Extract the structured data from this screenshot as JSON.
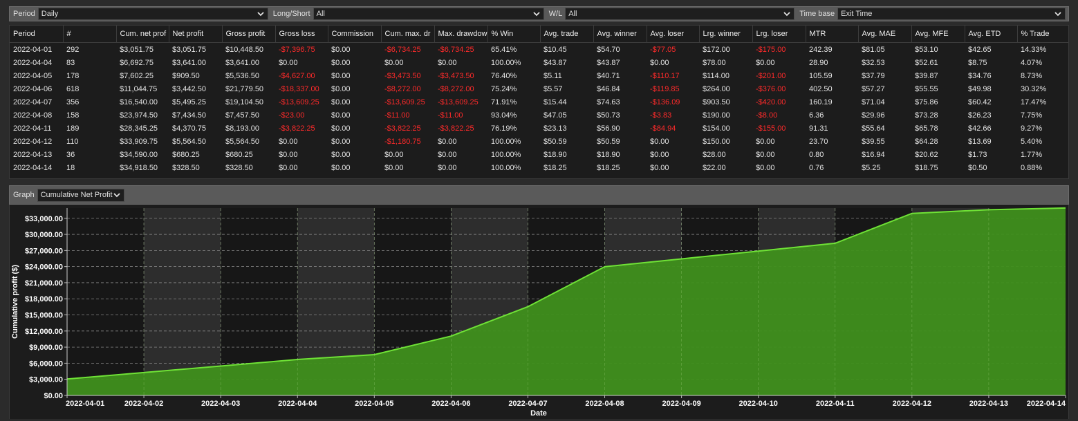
{
  "filters": [
    {
      "label": "Period",
      "value": "Daily"
    },
    {
      "label": "Long/Short",
      "value": "All"
    },
    {
      "label": "W/L",
      "value": "All"
    },
    {
      "label": "Time base",
      "value": "Exit Time"
    }
  ],
  "table": {
    "columns": [
      "Period",
      "#",
      "Cum. net prof",
      "Net profit",
      "Gross profit",
      "Gross loss",
      "Commission",
      "Cum. max. dr",
      "Max. drawdow",
      "% Win",
      "Avg. trade",
      "Avg. winner",
      "Avg. loser",
      "Lrg. winner",
      "Lrg. loser",
      "MTR",
      "Avg. MAE",
      "Avg. MFE",
      "Avg. ETD",
      "% Trade"
    ],
    "rows": [
      [
        "2022-04-01",
        "292",
        "$3,051.75",
        "$3,051.75",
        "$10,448.50",
        "-$7,396.75",
        "$0.00",
        "-$6,734.25",
        "-$6,734.25",
        "65.41%",
        "$10.45",
        "$54.70",
        "-$77.05",
        "$172.00",
        "-$175.00",
        "242.39",
        "$81.05",
        "$53.10",
        "$42.65",
        "14.33%"
      ],
      [
        "2022-04-04",
        "83",
        "$6,692.75",
        "$3,641.00",
        "$3,641.00",
        "$0.00",
        "$0.00",
        "$0.00",
        "$0.00",
        "100.00%",
        "$43.87",
        "$43.87",
        "$0.00",
        "$78.00",
        "$0.00",
        "28.90",
        "$32.53",
        "$52.61",
        "$8.75",
        "4.07%"
      ],
      [
        "2022-04-05",
        "178",
        "$7,602.25",
        "$909.50",
        "$5,536.50",
        "-$4,627.00",
        "$0.00",
        "-$3,473.50",
        "-$3,473.50",
        "76.40%",
        "$5.11",
        "$40.71",
        "-$110.17",
        "$114.00",
        "-$201.00",
        "105.59",
        "$37.79",
        "$39.87",
        "$34.76",
        "8.73%"
      ],
      [
        "2022-04-06",
        "618",
        "$11,044.75",
        "$3,442.50",
        "$21,779.50",
        "-$18,337.00",
        "$0.00",
        "-$8,272.00",
        "-$8,272.00",
        "75.24%",
        "$5.57",
        "$46.84",
        "-$119.85",
        "$264.00",
        "-$376.00",
        "402.50",
        "$57.27",
        "$55.55",
        "$49.98",
        "30.32%"
      ],
      [
        "2022-04-07",
        "356",
        "$16,540.00",
        "$5,495.25",
        "$19,104.50",
        "-$13,609.25",
        "$0.00",
        "-$13,609.25",
        "-$13,609.25",
        "71.91%",
        "$15.44",
        "$74.63",
        "-$136.09",
        "$903.50",
        "-$420.00",
        "160.19",
        "$71.04",
        "$75.86",
        "$60.42",
        "17.47%"
      ],
      [
        "2022-04-08",
        "158",
        "$23,974.50",
        "$7,434.50",
        "$7,457.50",
        "-$23.00",
        "$0.00",
        "-$11.00",
        "-$11.00",
        "93.04%",
        "$47.05",
        "$50.73",
        "-$3.83",
        "$190.00",
        "-$8.00",
        "6.36",
        "$29.96",
        "$73.28",
        "$26.23",
        "7.75%"
      ],
      [
        "2022-04-11",
        "189",
        "$28,345.25",
        "$4,370.75",
        "$8,193.00",
        "-$3,822.25",
        "$0.00",
        "-$3,822.25",
        "-$3,822.25",
        "76.19%",
        "$23.13",
        "$56.90",
        "-$84.94",
        "$154.00",
        "-$155.00",
        "91.31",
        "$55.64",
        "$65.78",
        "$42.66",
        "9.27%"
      ],
      [
        "2022-04-12",
        "110",
        "$33,909.75",
        "$5,564.50",
        "$5,564.50",
        "$0.00",
        "$0.00",
        "-$1,180.75",
        "$0.00",
        "100.00%",
        "$50.59",
        "$50.59",
        "$0.00",
        "$150.00",
        "$0.00",
        "23.70",
        "$39.55",
        "$64.28",
        "$13.69",
        "5.40%"
      ],
      [
        "2022-04-13",
        "36",
        "$34,590.00",
        "$680.25",
        "$680.25",
        "$0.00",
        "$0.00",
        "$0.00",
        "$0.00",
        "100.00%",
        "$18.90",
        "$18.90",
        "$0.00",
        "$28.00",
        "$0.00",
        "0.80",
        "$16.94",
        "$20.62",
        "$1.73",
        "1.77%"
      ],
      [
        "2022-04-14",
        "18",
        "$34,918.50",
        "$328.50",
        "$328.50",
        "$0.00",
        "$0.00",
        "$0.00",
        "$0.00",
        "100.00%",
        "$18.25",
        "$18.25",
        "$0.00",
        "$22.00",
        "$0.00",
        "0.76",
        "$5.25",
        "$18.75",
        "$0.50",
        "0.88%"
      ]
    ]
  },
  "graph": {
    "label": "Graph",
    "selected": "Cumulative Net Profit"
  },
  "colors": {
    "negative": "#ff2a2a",
    "area_fill": "#3f8f1c",
    "line": "#6fe236",
    "plot_bg_dark": "#171717",
    "plot_bg_band": "#2d2d2d"
  },
  "chart_data": {
    "type": "area",
    "xlabel": "Date",
    "ylabel": "Cumulative profit ($)",
    "x": [
      "2022-04-01",
      "2022-04-02",
      "2022-04-03",
      "2022-04-04",
      "2022-04-05",
      "2022-04-06",
      "2022-04-07",
      "2022-04-08",
      "2022-04-09",
      "2022-04-10",
      "2022-04-11",
      "2022-04-12",
      "2022-04-13",
      "2022-04-14"
    ],
    "series": [
      {
        "values": [
          3051.75,
          4265,
          5479,
          6692.75,
          7602.25,
          11044.75,
          16540.0,
          23974.5,
          25431,
          26888,
          28345.25,
          33909.75,
          34590.0,
          34918.5
        ]
      }
    ],
    "yticks": [
      "$0.00",
      "$3,000.00",
      "$6,000.00",
      "$9,000.00",
      "$12,000.00",
      "$15,000.00",
      "$18,000.00",
      "$21,000.00",
      "$24,000.00",
      "$27,000.00",
      "$30,000.00",
      "$33,000.00"
    ],
    "ylim": [
      0,
      35000
    ],
    "grid": true
  }
}
